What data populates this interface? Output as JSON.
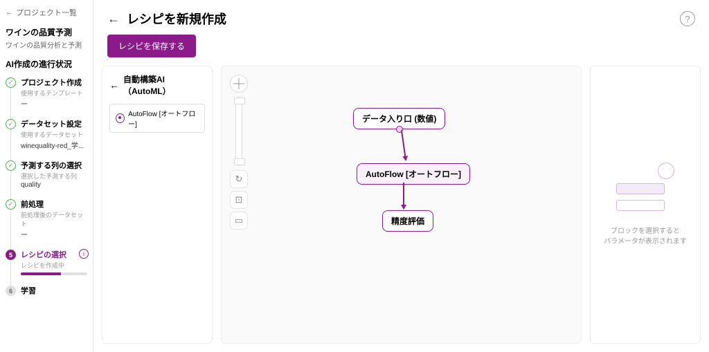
{
  "sidebar": {
    "back": "プロジェクト一覧",
    "project_title": "ワインの品質予測",
    "project_sub": "ワインの品質分析と予測",
    "section": "AI作成の進行状況",
    "steps": [
      {
        "label": "プロジェクト作成",
        "desc": "使用するテンプレート",
        "val": "ー"
      },
      {
        "label": "データセット設定",
        "desc": "使用するデータセット",
        "val": "winequality-red_学..."
      },
      {
        "label": "予測する列の選択",
        "desc": "選択した予測する列",
        "val": "quality"
      },
      {
        "label": "前処理",
        "desc": "前処理後のデータセット",
        "val": "ー"
      },
      {
        "num": "5",
        "label": "レシピの選択",
        "desc": "レシピを作成中"
      },
      {
        "num": "6",
        "label": "学習"
      }
    ]
  },
  "header": {
    "title": "レシピを新規作成"
  },
  "toolbar": {
    "save": "レシピを保存する"
  },
  "left_panel": {
    "title": "自動構築AI（AutoML）",
    "block": "AutoFlow [オートフロー]"
  },
  "canvas": {
    "nodes": {
      "input": "データ入り口 (数値)",
      "autoflow": "AutoFlow [オートフロー]",
      "eval": "精度評価"
    }
  },
  "right_panel": {
    "hint1": "ブロックを選択すると",
    "hint2": "パラメータが表示されます"
  }
}
